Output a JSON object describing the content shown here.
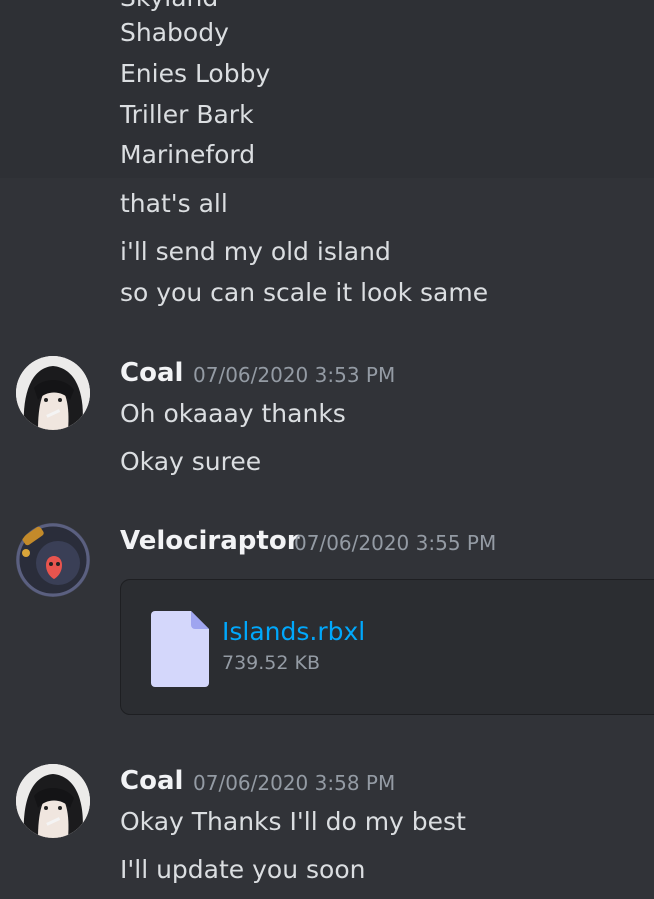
{
  "top_messages": {
    "list_lines": [
      "Shabody",
      "Enies Lobby",
      "Triller Bark",
      "Marineford"
    ],
    "lines": [
      "that's all",
      "i'll send my old island",
      "so you can scale it look same"
    ]
  },
  "msg_coal_1": {
    "author": "Coal",
    "timestamp": "07/06/2020 3:53 PM",
    "lines": [
      "Oh okaaay thanks",
      "Okay suree"
    ]
  },
  "msg_velociraptor": {
    "author": "Velociraptor",
    "timestamp": "07/06/2020 3:55 PM",
    "attachment": {
      "filename": "Islands.rbxl",
      "size": "739.52 KB",
      "icon": "file-icon"
    }
  },
  "msg_coal_2": {
    "author": "Coal",
    "timestamp": "07/06/2020 3:58 PM",
    "lines": [
      "Okay Thanks I'll do my best",
      "I'll update you soon"
    ]
  },
  "colors": {
    "background": "#313338",
    "highlight": "#2e3035",
    "link": "#00a8fc",
    "timestamp": "#949ba4",
    "username": "#f2f3f5"
  }
}
